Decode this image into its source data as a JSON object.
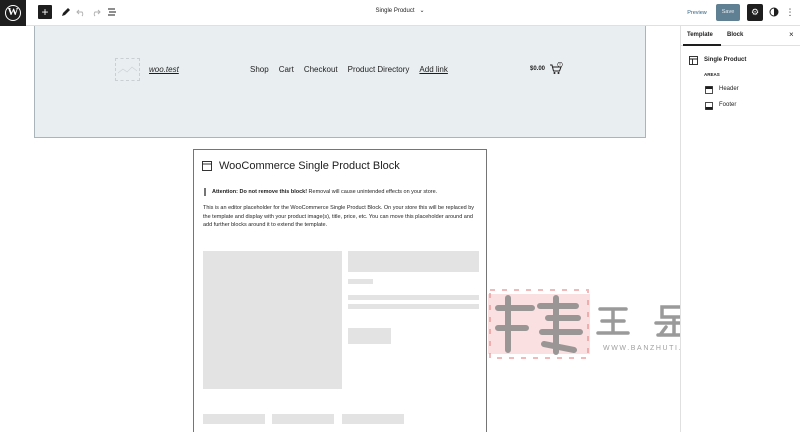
{
  "topbar": {
    "add_symbol": "+",
    "document_title": "Single Product",
    "preview_label": "Preview",
    "save_label": "Save"
  },
  "header": {
    "site_title": "woo.test",
    "nav": [
      "Shop",
      "Cart",
      "Checkout",
      "Product Directory",
      "Add link"
    ],
    "cart_price": "$0.00",
    "cart_count": "0"
  },
  "product_block": {
    "title": "WooCommerce Single Product Block",
    "attention_bold": "Attention: Do not remove this block!",
    "attention_text": " Removal will cause unintended effects on your store.",
    "description": "This is an editor placeholder for the WooCommerce Single Product Block. On your store this will be replaced by the template and display with your product image(s), title, price, etc. You can move this placeholder around and add further blocks around it to extend the template."
  },
  "sidebar": {
    "tabs": [
      "Template",
      "Block"
    ],
    "active_tab": "Template",
    "template_name": "Single Product",
    "areas_heading": "AREAS",
    "areas": [
      "Header",
      "Footer"
    ]
  },
  "watermark": {
    "url": "WWW.BANZHUTI.COM"
  },
  "colors": {
    "accent": "#2271b1",
    "save_button": "#5f7f92",
    "header_bg": "#e9eef1",
    "placeholder": "#e3e3e3"
  }
}
